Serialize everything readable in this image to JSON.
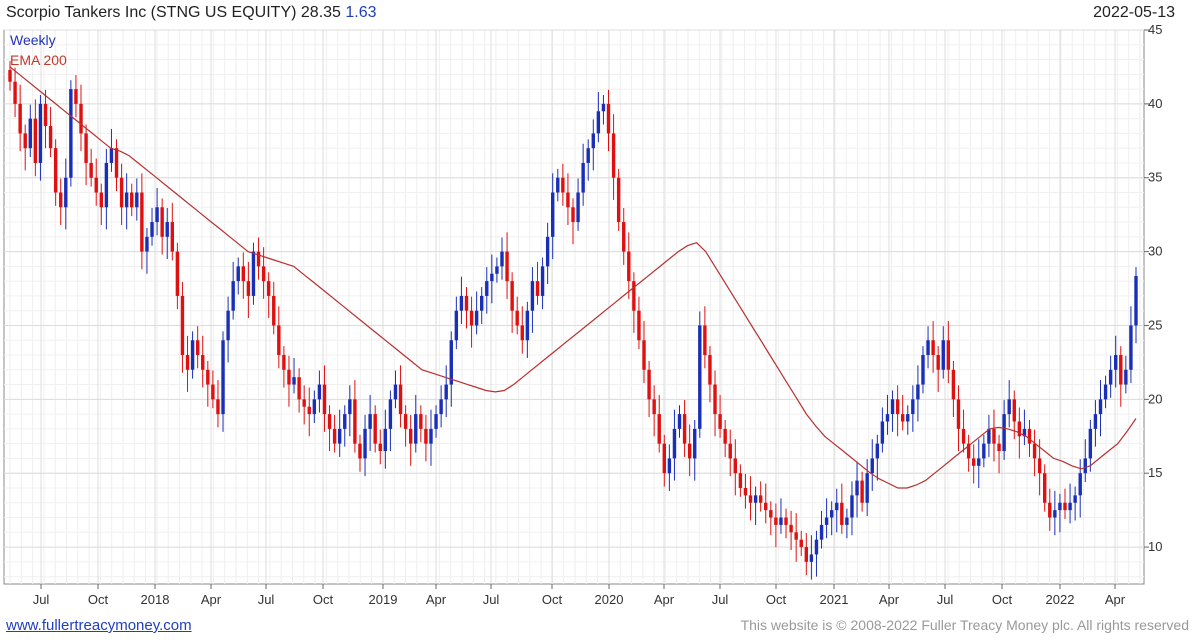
{
  "header": {
    "title": "Scorpio Tankers Inc (STNG US EQUITY)",
    "last_price": "28.35",
    "change": "1.63",
    "date": "2022-05-13"
  },
  "legend": {
    "frequency": "Weekly",
    "ema_label": "EMA 200"
  },
  "footer": {
    "link_text": "www.fullertreacymoney.com",
    "copyright": "This website is © 2008-2022 Fuller Treacy Money plc. All rights reserved"
  },
  "colors": {
    "up": "#1a2fb8",
    "down": "#e01010",
    "ema": "#b83030",
    "grid": "#dcdcdc"
  },
  "chart_data": {
    "type": "candlestick",
    "title": "Scorpio Tankers Inc (STNG US EQUITY)",
    "frequency": "weekly",
    "x_ticks": [
      "Jul",
      "Oct",
      "2018",
      "Apr",
      "Jul",
      "Oct",
      "2019",
      "Apr",
      "Jul",
      "Oct",
      "2020",
      "Apr",
      "Jul",
      "Oct",
      "2021",
      "Apr",
      "Jul",
      "Oct",
      "2022",
      "Apr"
    ],
    "x_range": [
      "2017-05",
      "2022-05-13"
    ],
    "y_ticks": [
      10,
      15,
      20,
      25,
      30,
      35,
      40,
      45
    ],
    "ylim": [
      7.5,
      45
    ],
    "y_axis_side": "right",
    "grid": true,
    "series": [
      {
        "name": "Weekly",
        "note": "weekly candles; approximate closing levels read from the chart",
        "closes": [
          41.5,
          40,
          38,
          37,
          39,
          36,
          40,
          38.5,
          37,
          34,
          33,
          35,
          41,
          40,
          38,
          36,
          35,
          34,
          33,
          36,
          37,
          35,
          33,
          34,
          33,
          34,
          30,
          31,
          32,
          33,
          31,
          32,
          30,
          27,
          23,
          22,
          24,
          23,
          22,
          21,
          20,
          19,
          24,
          26,
          28,
          29,
          28,
          27,
          30,
          29,
          28,
          27,
          25,
          23,
          22,
          21,
          21.5,
          20,
          19.5,
          19,
          20,
          21,
          19,
          18,
          17,
          18,
          19,
          20,
          17,
          16,
          18,
          19,
          17,
          16.5,
          18,
          20,
          21,
          19,
          18,
          17,
          19,
          18,
          17,
          18,
          19,
          20,
          21,
          24,
          26,
          27,
          26,
          25,
          26,
          27,
          28,
          28.5,
          29,
          30,
          28,
          26,
          25,
          24,
          26,
          28,
          27,
          29,
          31,
          34,
          35,
          34,
          33,
          32,
          34,
          36,
          37,
          38,
          39.5,
          40,
          38,
          35,
          32,
          30,
          28,
          26,
          24,
          22,
          20,
          19,
          17,
          15,
          16,
          18,
          19,
          17,
          16,
          18,
          25,
          23,
          21,
          19,
          18,
          17,
          16,
          15,
          14,
          13.5,
          13,
          13.5,
          13,
          12.5,
          12,
          11.5,
          12,
          11.5,
          11,
          10.5,
          10,
          9,
          9.5,
          10.5,
          11.5,
          12,
          12.5,
          13,
          11.5,
          12,
          13.5,
          14.5,
          13,
          15,
          16,
          17,
          18.5,
          19,
          20,
          19,
          18.5,
          19,
          20,
          21,
          23,
          24,
          23,
          22,
          24,
          22,
          20,
          18,
          17,
          16,
          15.5,
          16,
          17,
          18,
          17,
          16.5,
          19,
          20,
          18.5,
          17.5,
          18,
          17,
          16,
          15,
          13,
          12,
          12.5,
          13,
          12.5,
          13,
          13.5,
          15,
          16,
          18,
          19,
          20,
          21,
          22,
          23,
          21,
          22,
          25,
          28.35
        ]
      },
      {
        "name": "EMA 200",
        "note": "approximate EMA level per week",
        "values": [
          42.5,
          42,
          41.5,
          41,
          40.5,
          40,
          39.5,
          39,
          38.5,
          38,
          37.5,
          37,
          36.8,
          36.5,
          36,
          35.5,
          35,
          34.5,
          34,
          33.5,
          33,
          32.5,
          32,
          31.5,
          31,
          30.5,
          30,
          29.8,
          29.6,
          29.4,
          29.2,
          29,
          28.5,
          28,
          27.5,
          27,
          26.5,
          26,
          25.5,
          25,
          24.5,
          24,
          23.5,
          23,
          22.5,
          22,
          21.8,
          21.6,
          21.4,
          21.2,
          21,
          20.8,
          20.6,
          20.5,
          20.6,
          21,
          21.5,
          22,
          22.5,
          23,
          23.5,
          24,
          24.5,
          25,
          25.5,
          26,
          26.5,
          27,
          27.5,
          28,
          28.5,
          29,
          29.5,
          30,
          30.4,
          30.6,
          30,
          29,
          28,
          27,
          26,
          25,
          24,
          23,
          22,
          21,
          20,
          19,
          18.2,
          17.5,
          17,
          16.5,
          16,
          15.5,
          15,
          14.6,
          14.3,
          14,
          14,
          14.2,
          14.5,
          15,
          15.5,
          16,
          16.5,
          17,
          17.5,
          18,
          18.1,
          18,
          17.8,
          17.5,
          17,
          16.5,
          16,
          15.8,
          15.5,
          15.3,
          15.5,
          16,
          16.5,
          17,
          17.8,
          18.7
        ]
      }
    ]
  }
}
